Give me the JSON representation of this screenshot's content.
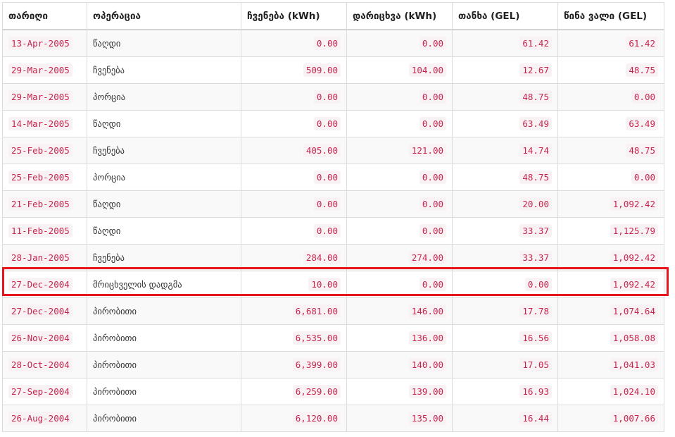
{
  "table": {
    "headers": [
      "თარიღი",
      "ოპერაცია",
      "ჩვენება (kWh)",
      "დარიცხვა (kWh)",
      "თანხა (GEL)",
      "წინა ვალი (GEL)"
    ],
    "rows": [
      [
        "13-Apr-2005",
        "წაღდი",
        "0.00",
        "0.00",
        "61.42",
        "61.42"
      ],
      [
        "29-Mar-2005",
        "ჩვენება",
        "509.00",
        "104.00",
        "12.67",
        "48.75"
      ],
      [
        "29-Mar-2005",
        "პორცია",
        "0.00",
        "0.00",
        "48.75",
        "0.00"
      ],
      [
        "14-Mar-2005",
        "წაღდი",
        "0.00",
        "0.00",
        "63.49",
        "63.49"
      ],
      [
        "25-Feb-2005",
        "ჩვენება",
        "405.00",
        "121.00",
        "14.74",
        "48.75"
      ],
      [
        "25-Feb-2005",
        "პორცია",
        "0.00",
        "0.00",
        "48.75",
        "0.00"
      ],
      [
        "21-Feb-2005",
        "წაღდი",
        "0.00",
        "0.00",
        "20.00",
        "1,092.42"
      ],
      [
        "11-Feb-2005",
        "წაღდი",
        "0.00",
        "0.00",
        "33.37",
        "1,125.79"
      ],
      [
        "28-Jan-2005",
        "ჩვენება",
        "284.00",
        "274.00",
        "33.37",
        "1,092.42"
      ],
      [
        "27-Dec-2004",
        "მრიცხველის დადგმა",
        "10.00",
        "0.00",
        "0.00",
        "1,092.42"
      ],
      [
        "27-Dec-2004",
        "პირობითი",
        "6,681.00",
        "146.00",
        "17.78",
        "1,074.64"
      ],
      [
        "26-Nov-2004",
        "პირობითი",
        "6,535.00",
        "136.00",
        "16.56",
        "1,058.08"
      ],
      [
        "28-Oct-2004",
        "პირობითი",
        "6,399.00",
        "140.00",
        "17.05",
        "1,041.03"
      ],
      [
        "27-Sep-2004",
        "პირობითი",
        "6,259.00",
        "139.00",
        "16.93",
        "1,024.10"
      ],
      [
        "26-Aug-2004",
        "პირობითი",
        "6,120.00",
        "135.00",
        "16.44",
        "1,007.66"
      ]
    ],
    "highlighted_row": 9,
    "highlight_color": "#e8141b",
    "value_color": "#c7254e",
    "value_bg": "#f9f2f4"
  }
}
